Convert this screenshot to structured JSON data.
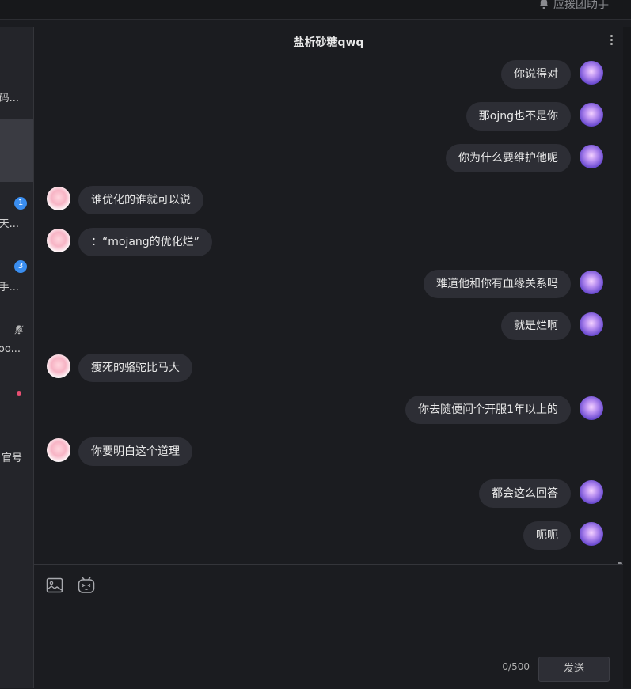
{
  "topbar": {
    "helper_label": "应援团助手",
    "helper_icon": "bell-icon"
  },
  "sidebar": {
    "items": [
      {
        "text": "码..."
      },
      {
        "text": "天...",
        "badge": "1"
      },
      {
        "text": "手...",
        "badge": "3"
      },
      {
        "text": "oo...",
        "icon": "bell-muted-icon"
      },
      {
        "text": "官号"
      }
    ]
  },
  "chat": {
    "title": "盐析砂糖qwq",
    "more_icon": "more-vertical-icon",
    "messages": [
      {
        "side": "right",
        "text": "你说得对"
      },
      {
        "side": "right",
        "text": "那ojng也不是你"
      },
      {
        "side": "right",
        "text": "你为什么要维护他呢"
      },
      {
        "side": "left",
        "text": "谁优化的谁就可以说"
      },
      {
        "side": "left",
        "text": "：“mojang的优化烂”"
      },
      {
        "side": "right",
        "text": "难道他和你有血缘关系吗"
      },
      {
        "side": "right",
        "text": "就是烂啊"
      },
      {
        "side": "left",
        "text": "瘦死的骆驼比马大"
      },
      {
        "side": "right",
        "text": "你去随便问个开服1年以上的"
      },
      {
        "side": "left",
        "text": "你要明白这个道理"
      },
      {
        "side": "right",
        "text": "都会这么回答"
      },
      {
        "side": "right",
        "text": "呃呃"
      }
    ]
  },
  "composer": {
    "image_icon": "image-icon",
    "emoji_icon": "emoji-icon",
    "counter": "0/500",
    "send_label": "发送"
  },
  "colors": {
    "background": "#1b1c20",
    "bubble": "#2d2e35",
    "sidebar": "#24252a",
    "badge": "#3a8ef0"
  }
}
